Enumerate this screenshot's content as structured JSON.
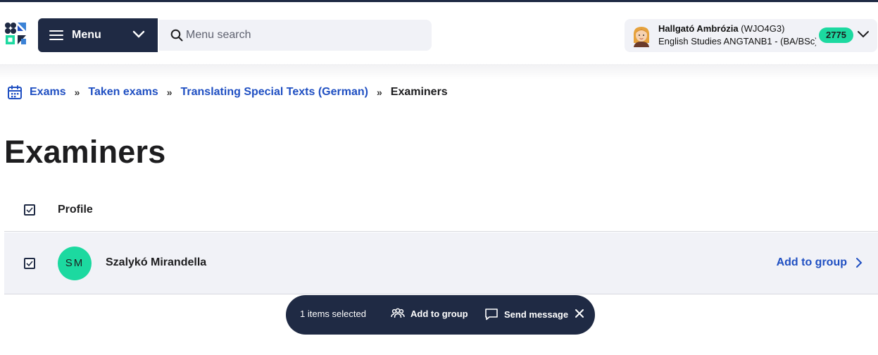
{
  "header": {
    "menu_label": "Menu",
    "search_placeholder": "Menu search",
    "user": {
      "name": "Hallgató Ambrózia",
      "code": "(WJO4G3)",
      "program": "English Studies ANGTANB1 - (BA/BSc)...",
      "badge_count": "2775"
    }
  },
  "breadcrumb": {
    "items": [
      "Exams",
      "Taken exams",
      "Translating Special Texts (German)"
    ],
    "current": "Examiners",
    "separator": "»"
  },
  "page": {
    "title": "Examiners"
  },
  "table": {
    "column_profile": "Profile",
    "rows": [
      {
        "initials": "SM",
        "name": "Szalykó Mirandella",
        "action": "Add to group",
        "selected": true
      }
    ]
  },
  "action_bar": {
    "selection_text": "1 items selected",
    "add_to_group": "Add to group",
    "send_message": "Send message"
  },
  "colors": {
    "navy": "#1f2a44",
    "link_blue": "#1f4fc2",
    "accent_green": "#1cd9a0",
    "row_bg": "#f1f2f7"
  }
}
